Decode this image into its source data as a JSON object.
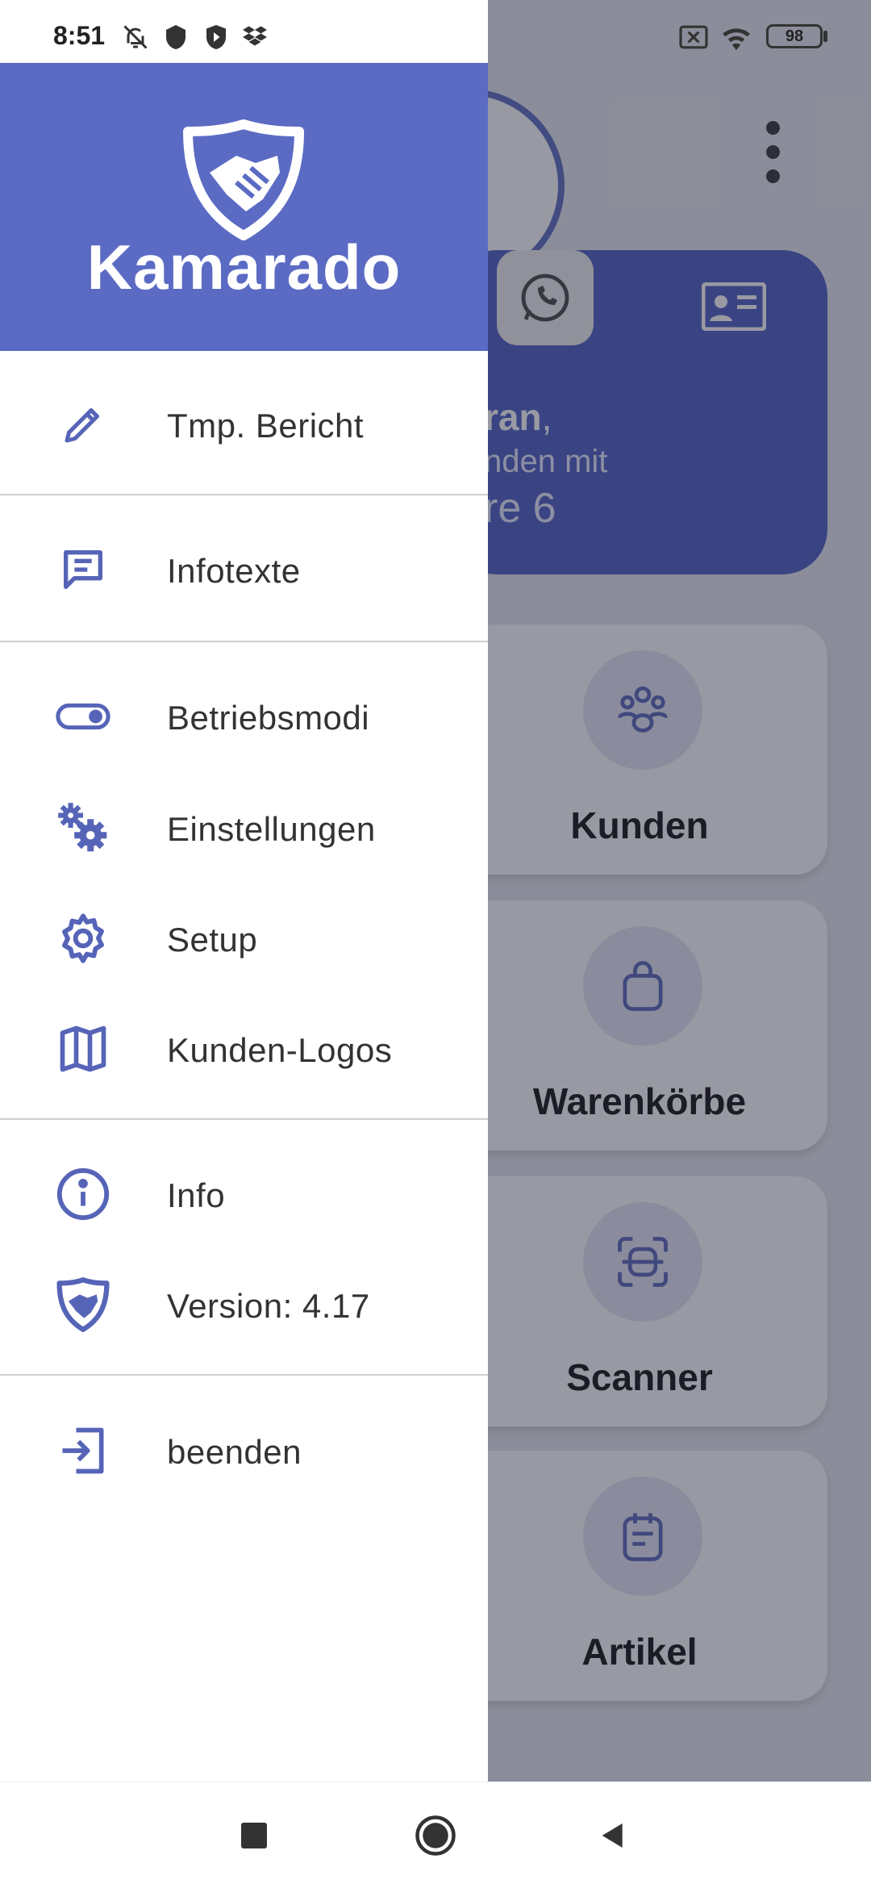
{
  "status_bar": {
    "time": "8:51",
    "battery": "98"
  },
  "drawer": {
    "brand": "Kamarado",
    "items": [
      {
        "label": "Tmp. Bericht",
        "icon": "pencil-icon"
      },
      {
        "label": "Infotexte",
        "icon": "message-icon"
      },
      {
        "label": "Betriebsmodi",
        "icon": "toggle-icon"
      },
      {
        "label": "Einstellungen",
        "icon": "gears-icon"
      },
      {
        "label": "Setup",
        "icon": "gear-icon"
      },
      {
        "label": "Kunden-Logos",
        "icon": "map-icon"
      },
      {
        "label": "Info",
        "icon": "info-icon"
      },
      {
        "label": "Version: 4.17",
        "icon": "shield-handshake-icon"
      },
      {
        "label": "beenden",
        "icon": "exit-icon"
      }
    ]
  },
  "background": {
    "greeting_name": "ran",
    "greeting_suffix": ",",
    "line2": "nden mit",
    "line3": "re 6",
    "tiles": [
      {
        "label": "Kunden",
        "icon": "users-icon"
      },
      {
        "label": "Warenkörbe",
        "icon": "bag-icon"
      },
      {
        "label": "Scanner",
        "icon": "scan-icon"
      },
      {
        "label": "Artikel",
        "icon": "clipboard-icon"
      }
    ]
  },
  "colors": {
    "primary": "#5b6bc4",
    "icon": "#5664b8",
    "text": "#333333"
  }
}
